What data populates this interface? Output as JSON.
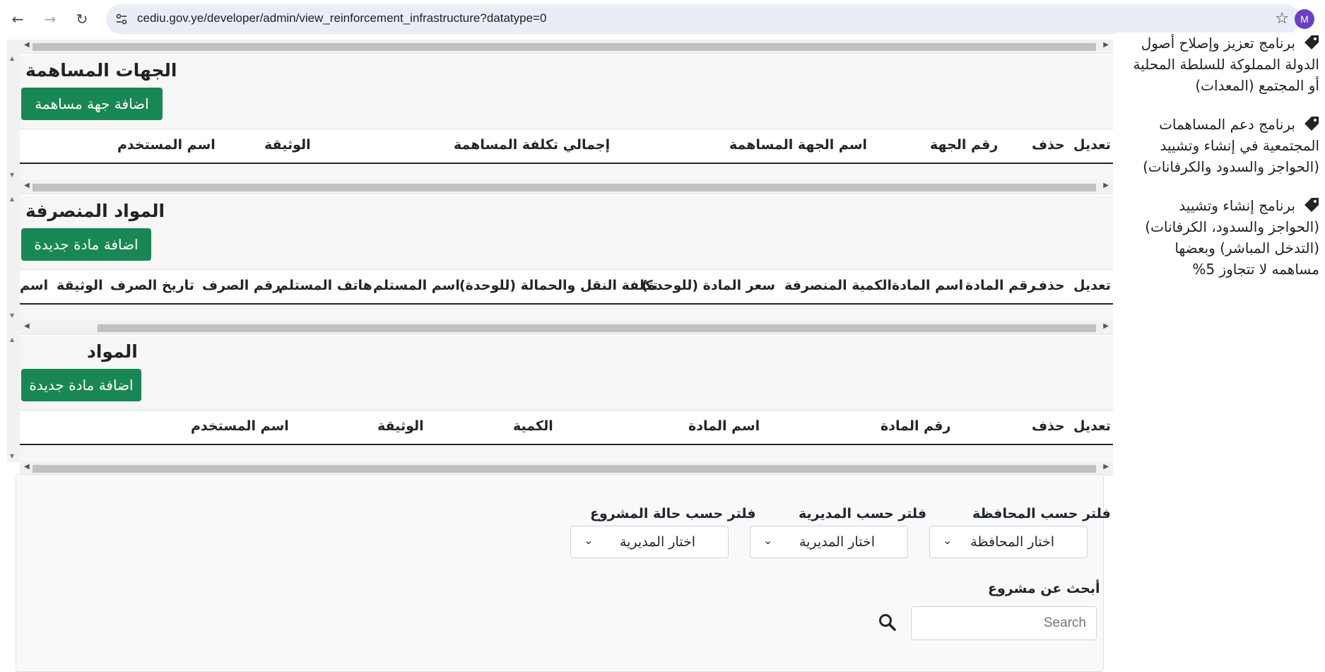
{
  "browser": {
    "url": "cediu.gov.ye/developer/admin/view_reinforcement_infrastructure?datatype=0",
    "avatar_letter": "M"
  },
  "sections": {
    "contributors": {
      "title": "الجهات المساهمة",
      "add_button": "اضافة جهة مساهمة",
      "columns": [
        "تعديل",
        "حذف",
        "رقم الجهة",
        "اسم الجهة المساهمة",
        "إجمالي تكلفة المساهمة",
        "الوثيقة",
        "اسم المستخدم"
      ]
    },
    "disbursed": {
      "title": "المواد المنصرفة",
      "add_button": "اضافة مادة جديدة",
      "columns": [
        "تعديل",
        "حذف",
        "رقم المادة",
        "اسم المادة",
        "الكمية المنصرفة",
        "سعر المادة (للوحدة)",
        "تكلفة النقل والحمالة (للوحدة)",
        "اسم المستلم",
        "هاتف المستلم",
        "رقم الصرف",
        "تاريخ الصرف",
        "الوثيقة",
        "اسم"
      ]
    },
    "materials": {
      "title": "المواد",
      "add_button": "اضافة مادة جديدة",
      "columns": [
        "تعديل",
        "حذف",
        "رقم المادة",
        "اسم المادة",
        "الكمية",
        "الوثيقة",
        "اسم المستخدم"
      ]
    }
  },
  "filters": {
    "governorate_label": "فلتر حسب المحافظة",
    "governorate_value": "اختار المحافظة",
    "directorate_label": "فلتر حسب المديرية",
    "directorate_value": "اختار المديرية",
    "status_label": "فلتر حسب حالة المشروع",
    "status_value": "اختار المديرية",
    "search_label": "أبحث عن مشروع",
    "search_placeholder": "Search"
  },
  "sidebar": {
    "items": [
      "برنامج تعزيز وإصلاح أصول الدولة المملوكة للسلطة المحلية أو المجتمع (المعدات)",
      "برنامج دعم المساهمات المجتمعية في إنشاء وتشييد (الحواجز والسدود والكرفانات)",
      "برنامج إنشاء وتشييد (الحواجز والسدود، الكرفانات) (التدخل المباشر) وبعضها مساهمه لا تتجاوز 5%"
    ]
  },
  "colors": {
    "accent": "#198754",
    "avatar": "#6b3fc3"
  }
}
